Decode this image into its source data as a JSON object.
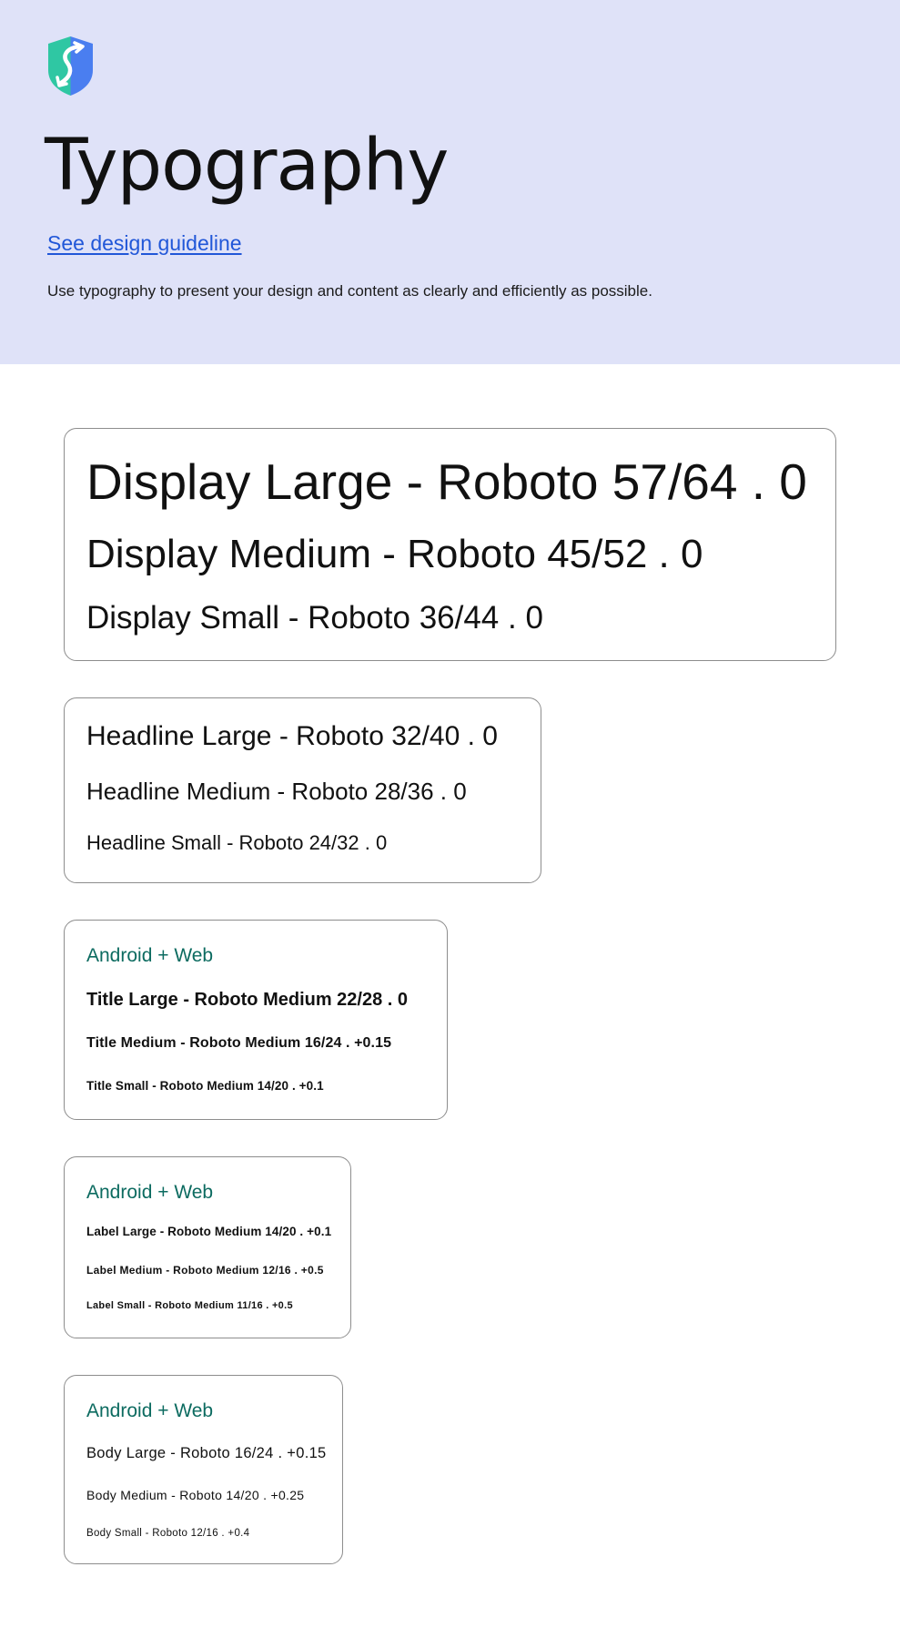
{
  "colors": {
    "hero_background": "#dfe2f8",
    "link": "#2157d8",
    "accent_tag": "#0c6b60",
    "card_border": "#8d8d8d",
    "logo_teal": "#2fc7a3",
    "logo_blue": "#4a7ef0"
  },
  "header": {
    "logo_icon": "shield-logo-icon",
    "title": "Typography",
    "guideline_link": "See design guideline",
    "description": "Use typography to present your design and content as clearly and efficiently as possible."
  },
  "cards": {
    "display": {
      "lines": [
        "Display Large - Roboto 57/64 . 0",
        "Display Medium - Roboto 45/52 .  0",
        "Display Small - Roboto 36/44 . 0"
      ]
    },
    "headline": {
      "lines": [
        "Headline Large - Roboto 32/40 . 0",
        "Headline Medium - Roboto 28/36 . 0",
        "Headline Small - Roboto 24/32 . 0"
      ]
    },
    "title": {
      "tag": "Android + Web",
      "lines": [
        "Title Large - Roboto Medium 22/28 . 0",
        "Title Medium - Roboto Medium 16/24 . +0.15",
        "Title Small - Roboto Medium 14/20 . +0.1"
      ]
    },
    "label": {
      "tag": "Android + Web",
      "lines": [
        "Label Large - Roboto Medium 14/20 . +0.1",
        "Label Medium - Roboto Medium 12/16 . +0.5",
        "Label Small - Roboto Medium 11/16 . +0.5"
      ]
    },
    "body": {
      "tag": "Android + Web",
      "lines": [
        "Body Large - Roboto 16/24 . +0.15",
        "Body Medium - Roboto 14/20 . +0.25",
        "Body Small - Roboto 12/16 . +0.4"
      ]
    }
  }
}
